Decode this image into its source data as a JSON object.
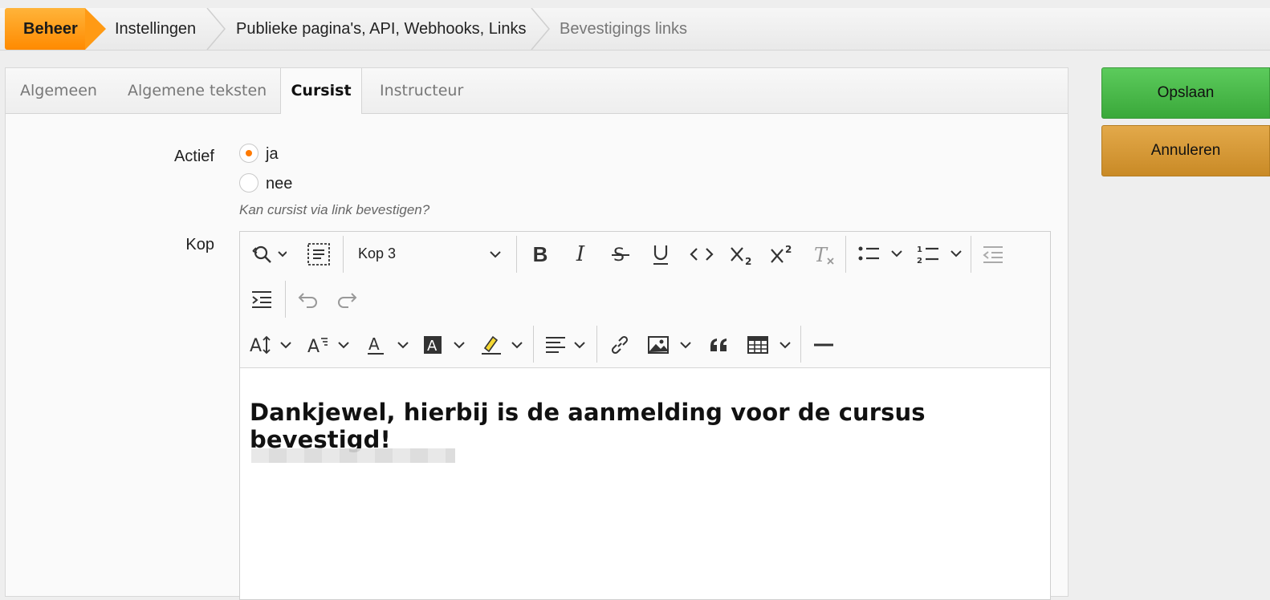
{
  "breadcrumb": {
    "items": [
      "Beheer",
      "Instellingen",
      "Publieke pagina's, API, Webhooks, Links",
      "Bevestigings links"
    ]
  },
  "tabs": [
    "Algemeen",
    "Algemene teksten",
    "Cursist",
    "Instructeur"
  ],
  "form": {
    "active_label": "Actief",
    "radio_yes": "ja",
    "radio_no": "nee",
    "hint": "Kan cursist via link bevestigen?",
    "heading_label": "Kop"
  },
  "editor": {
    "heading_select": "Kop 3",
    "content_heading": "Dankjewel, hierbij is de aanmelding voor de cursus bevestigd!"
  },
  "buttons": {
    "save": "Opslaan",
    "cancel": "Annuleren"
  },
  "colors": {
    "accent": "#ff8a00",
    "save": "#4cb84c",
    "cancel": "#d89a36"
  }
}
